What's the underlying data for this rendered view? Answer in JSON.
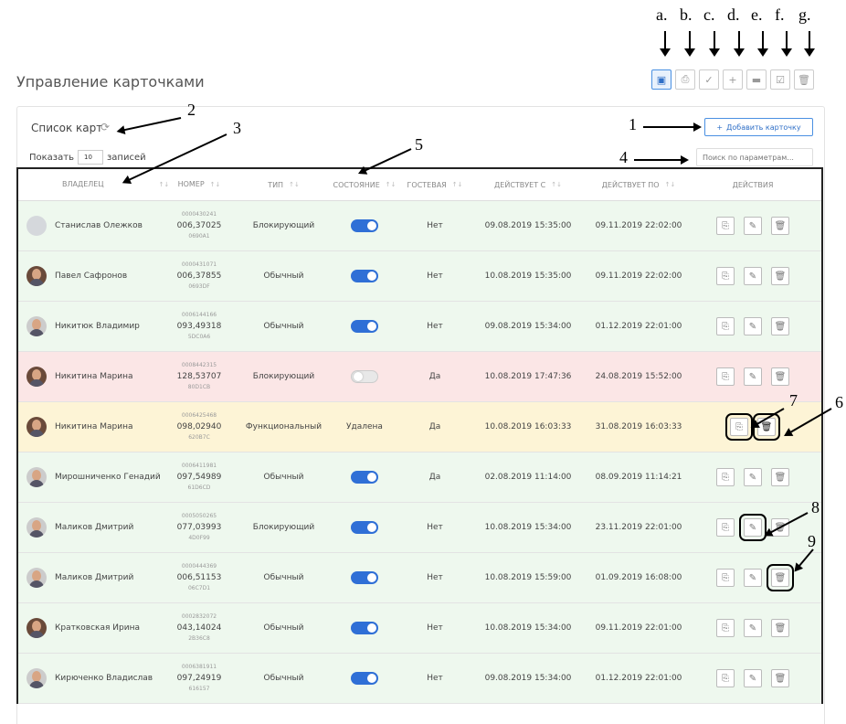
{
  "annotations": {
    "letters": [
      "a.",
      "b.",
      "c.",
      "d.",
      "e.",
      "f.",
      "g."
    ],
    "numbers": [
      "1",
      "2",
      "3",
      "4",
      "5",
      "6",
      "7",
      "8",
      "9"
    ]
  },
  "page": {
    "title": "Управление карточками"
  },
  "toolbar_icons": [
    "card-icon",
    "print-icon",
    "user-check-icon",
    "user-add-icon",
    "minus-icon",
    "check-icon",
    "trash-icon"
  ],
  "panel": {
    "title": "Список карт",
    "show_label": "Показать",
    "show_value": "10",
    "show_suffix": "записей",
    "add_button": "Добавить карточку",
    "add_plus": "+",
    "search_placeholder": "Поиск по параметрам..."
  },
  "columns": [
    "ВЛАДЕЛЕЦ",
    "НОМЕР",
    "ТИП",
    "СОСТОЯНИЕ",
    "ГОСТЕВАЯ",
    "ДЕЙСТВУЕТ С",
    "ДЕЙСТВУЕТ ПО",
    "ДЕЙСТВИЯ"
  ],
  "rows": [
    {
      "owner": "Станислав Олежков",
      "num_top": "0000430241",
      "num_main": "006,37025",
      "num_hex": "0690A1",
      "type": "Блокирующий",
      "state": "on",
      "guest": "Нет",
      "from": "09.08.2019 15:35:00",
      "to": "09.11.2019 22:02:00"
    },
    {
      "owner": "Павел Сафронов",
      "num_top": "0000431071",
      "num_main": "006,37855",
      "num_hex": "0693DF",
      "type": "Обычный",
      "state": "on",
      "guest": "Нет",
      "from": "10.08.2019 15:35:00",
      "to": "09.11.2019 22:02:00"
    },
    {
      "owner": "Никитюк Владимир",
      "num_top": "0006144166",
      "num_main": "093,49318",
      "num_hex": "5DC0A6",
      "type": "Обычный",
      "state": "on",
      "guest": "Нет",
      "from": "09.08.2019 15:34:00",
      "to": "01.12.2019 22:01:00"
    },
    {
      "owner": "Никитина Марина",
      "num_top": "0008442315",
      "num_main": "128,53707",
      "num_hex": "80D1CB",
      "type": "Блокирующий",
      "state": "off",
      "guest": "Да",
      "from": "10.08.2019 17:47:36",
      "to": "24.08.2019 15:52:00"
    },
    {
      "owner": "Никитина Марина",
      "num_top": "0006425468",
      "num_main": "098,02940",
      "num_hex": "620B7C",
      "type": "Функциональный",
      "state_text": "Удалена",
      "guest": "Да",
      "from": "10.08.2019 16:03:33",
      "to": "31.08.2019 16:03:33"
    },
    {
      "owner": "Мирошниченко Генадий",
      "num_top": "0006411981",
      "num_main": "097,54989",
      "num_hex": "61D6CD",
      "type": "Обычный",
      "state": "on",
      "guest": "Да",
      "from": "02.08.2019 11:14:00",
      "to": "08.09.2019 11:14:21"
    },
    {
      "owner": "Маликов Дмитрий",
      "num_top": "0005050265",
      "num_main": "077,03993",
      "num_hex": "4D0F99",
      "type": "Блокирующий",
      "state": "on",
      "guest": "Нет",
      "from": "10.08.2019 15:34:00",
      "to": "23.11.2019 22:01:00"
    },
    {
      "owner": "Маликов Дмитрий",
      "num_top": "0000444369",
      "num_main": "006,51153",
      "num_hex": "06C7D1",
      "type": "Обычный",
      "state": "on",
      "guest": "Нет",
      "from": "10.08.2019 15:59:00",
      "to": "01.09.2019 16:08:00"
    },
    {
      "owner": "Кратковская Ирина",
      "num_top": "0002832072",
      "num_main": "043,14024",
      "num_hex": "2B36C8",
      "type": "Обычный",
      "state": "on",
      "guest": "Нет",
      "from": "10.08.2019 15:34:00",
      "to": "09.11.2019 22:01:00"
    },
    {
      "owner": "Кирюченко Владислав",
      "num_top": "0006381911",
      "num_main": "097,24919",
      "num_hex": "616157",
      "type": "Обычный",
      "state": "on",
      "guest": "Нет",
      "from": "09.08.2019 15:34:00",
      "to": "01.12.2019 22:01:00"
    }
  ],
  "colors": {
    "accent": "#2f6fd6",
    "active_row": "#eef8ee",
    "blocked_row": "#fbe6e6",
    "deleted_row": "#fdf4d6"
  }
}
